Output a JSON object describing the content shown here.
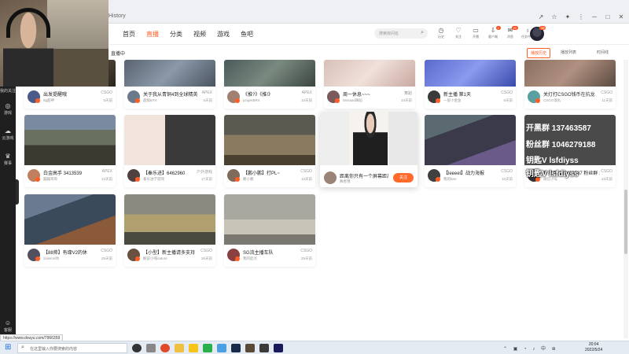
{
  "window": {
    "title": "History"
  },
  "nav": {
    "links": [
      "首页",
      "直播",
      "分类",
      "视频",
      "游戏",
      "鱼吧"
    ],
    "active": "直播",
    "search_placeholder": "搜索房间名",
    "tools": [
      {
        "label": "历史",
        "icon": "clock-icon",
        "badge": ""
      },
      {
        "label": "关注",
        "icon": "heart-icon",
        "badge": ""
      },
      {
        "label": "开播",
        "icon": "camera-icon",
        "badge": ""
      },
      {
        "label": "客户端",
        "icon": "download-icon",
        "badge": "1"
      },
      {
        "label": "消息",
        "icon": "message-icon",
        "badge": "20"
      },
      {
        "label": "任务中心",
        "icon": "bulb-icon",
        "badge": ""
      }
    ],
    "avatar_badge": "38"
  },
  "subbar": {
    "live_label": "直播中",
    "history_btn": "播放历史",
    "view_btn": "播放列表",
    "time_btn": "时间线"
  },
  "cards": [
    {
      "title": "出发提醒哦",
      "cat": "CSGO",
      "name": "8g超神",
      "heat": "5天前"
    },
    {
      "title": "关于我从青铜4到全球精英",
      "cat": "APEX",
      "name": "超级BT4",
      "heat": "5天前"
    },
    {
      "title": "《推?》《推!》",
      "cat": "APEX",
      "name": "jungerBR4",
      "heat": "10天前"
    },
    {
      "title": "周一休息~~~",
      "cat": "舞蹈",
      "name": "Mosaas舞蹈",
      "heat": "10天前"
    },
    {
      "title": "新主播 第1天",
      "cat": "CSGO",
      "name": "一留小金鱼",
      "heat": "5天前"
    },
    {
      "title": "关灯打CSGO钱币在抗龙",
      "cat": "CSGO",
      "name": "CSGO瑞丸",
      "heat": "11天前"
    },
    {
      "title": "白金高手 3413539",
      "cat": "APEX",
      "name": "蹦蹦哥哥",
      "heat": "13天前"
    },
    {
      "title": "【秦乐进】6462960",
      "cat": "户外游戏",
      "name": "秦乐进学游戏",
      "heat": "17天前"
    },
    {
      "title": "【鹏小鹏】打PL~",
      "cat": "CSGO",
      "name": "鹏小鹏",
      "heat": "10天前"
    },
    {
      "title": "【leeeel】战力海报",
      "cat": "CSGO",
      "name": "我的bee",
      "heat": "10天前"
    },
    {
      "title": "开黑群 137463587 粉丝群 1046279188",
      "cat": "CSGO",
      "name": "微信小号",
      "heat": "23天前"
    },
    {
      "title": "【88帅】有缘V2的休",
      "cat": "CSGO",
      "name": "Solemn帅",
      "heat": "25天前"
    },
    {
      "title": "【小型】新主播请多支持",
      "cat": "CSGO",
      "name": "解说小嗨nature",
      "heat": "26天前"
    },
    {
      "title": "SG流主播车队",
      "cat": "CSGO",
      "name": "我的起点",
      "heat": "25天前"
    }
  ],
  "hover_card": {
    "title": "距离你只有一个屏幕距离",
    "name": "舞者哦",
    "follow": "关注"
  },
  "overlay_text": {
    "line1": "开黑群 137463587",
    "line2": "粉丝群 1046279188",
    "line3": "钥匙V lsfdiyss",
    "line4": "钥匙V lsfdiyss"
  },
  "status_url": "https://www.douyu.com/7966359",
  "taskbar": {
    "search_placeholder": "在这里输入你要搜索的内容",
    "time": "20:04",
    "date": "2022/5/24"
  },
  "rail": [
    {
      "label": "我的关注",
      "icon": "heart-icon"
    },
    {
      "label": "游戏",
      "icon": "gamepad-icon"
    },
    {
      "label": "云游戏",
      "icon": "cloud-game-icon"
    },
    {
      "label": "赛事",
      "icon": "trophy-icon"
    },
    {
      "label": "客服",
      "icon": "service-icon"
    }
  ]
}
